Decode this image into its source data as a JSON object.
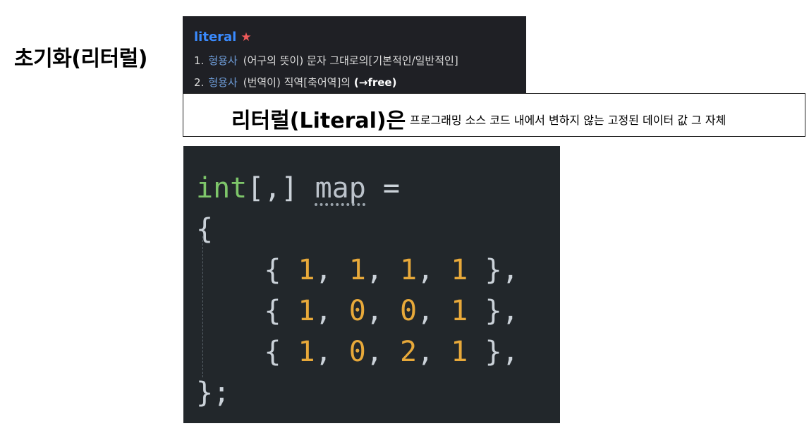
{
  "side_title": "초기화(리터럴)",
  "dictionary": {
    "word": "literal",
    "star": "★",
    "senses": [
      {
        "number": "1.",
        "pos": "형용사",
        "text": "(어구의 뜻이) 문자 그대로의[기본적인/일반적인]",
        "extra": ""
      },
      {
        "number": "2.",
        "pos": "형용사",
        "text": "(번역이) 직역[축어역]의",
        "extra": "(→free)"
      }
    ]
  },
  "definition": {
    "term": "리터럴(Literal)은",
    "description": "프로그래밍 소스 코드 내에서 변하지 않는 고정된 데이터 값 그 자체"
  },
  "code": {
    "line1": {
      "type": "int",
      "rest": "[,] ",
      "ident": "map",
      "op": " ="
    },
    "open": "{",
    "rows": [
      {
        "open": "    { ",
        "a": "1",
        "b": "1",
        "c": "1",
        "d": "1",
        "close": " },"
      },
      {
        "open": "    { ",
        "a": "1",
        "b": "0",
        "c": "0",
        "d": "1",
        "close": " },"
      },
      {
        "open": "    { ",
        "a": "1",
        "b": "0",
        "c": "2",
        "d": "1",
        "close": " },"
      }
    ],
    "close": "};"
  }
}
